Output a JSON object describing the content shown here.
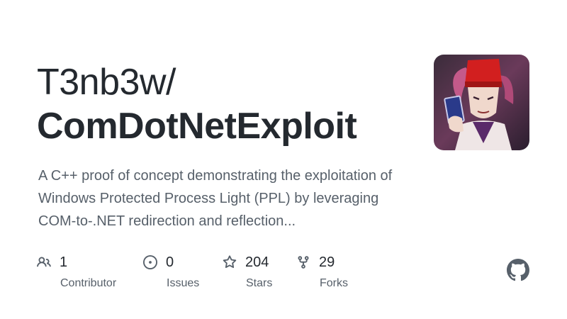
{
  "repo": {
    "owner": "T3nb3w/",
    "name": "ComDotNetExploit",
    "description": "A C++ proof of concept demonstrating the exploitation of Windows Protected Process Light (PPL) by leveraging COM-to-.NET redirection and reflection..."
  },
  "stats": [
    {
      "icon": "people-icon",
      "value": "1",
      "label": "Contributor"
    },
    {
      "icon": "issue-icon",
      "value": "0",
      "label": "Issues"
    },
    {
      "icon": "star-icon",
      "value": "204",
      "label": "Stars"
    },
    {
      "icon": "fork-icon",
      "value": "29",
      "label": "Forks"
    }
  ],
  "colors": {
    "text": "#24292f",
    "muted": "#57606a",
    "icon": "#57606a"
  }
}
